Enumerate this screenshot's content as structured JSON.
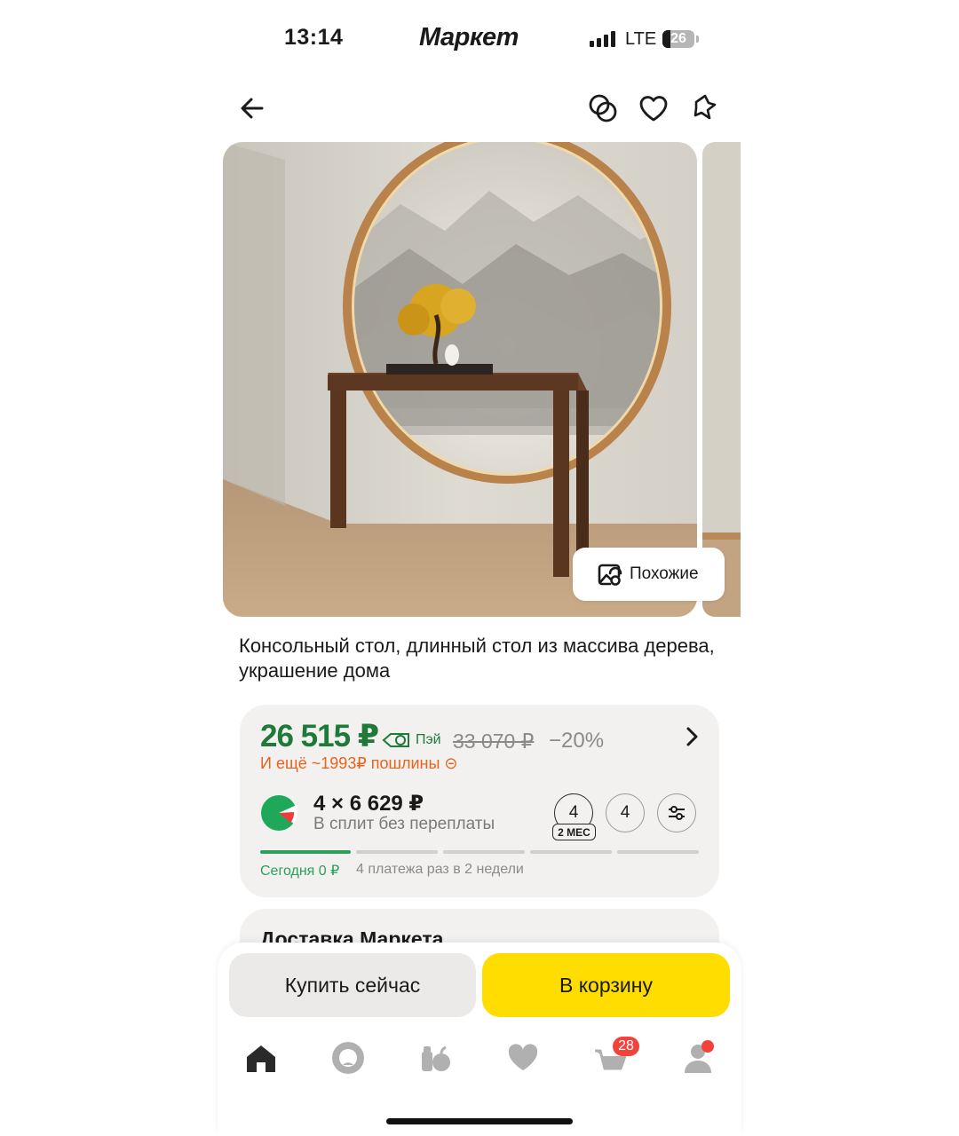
{
  "status_bar": {
    "time": "13:14",
    "app_name": "Маркет",
    "network": "LTE",
    "battery": "26",
    "battery_level": 0.26
  },
  "header": {
    "icons": [
      "back-arrow-icon",
      "compare-icon",
      "heart-icon",
      "share-icon"
    ]
  },
  "gallery": {
    "similar_label": "Похожие"
  },
  "product": {
    "title": "Консольный стол, длинный стол из массива дерева, украшение дома"
  },
  "price": {
    "current": "26 515 ₽",
    "pay_label": "Пэй",
    "old": "33 070 ₽",
    "discount": "−20%",
    "duty_note": "И ещё ~1993₽ пошлины ⊝",
    "split_amount": "4 × 6 629 ₽",
    "split_note": "В сплит без переплаты",
    "option_1": "4",
    "option_1_tag": "2 МЕС",
    "option_2": "4",
    "today": "Сегодня 0 ₽",
    "schedule": "4 платежа раз в 2 недели"
  },
  "delivery": {
    "title": "Доставка Маркета"
  },
  "actions": {
    "buy_now": "Купить сейчас",
    "add_to_cart": "В корзину"
  },
  "tabbar": {
    "cart_badge": "28"
  },
  "colors": {
    "price_green": "#1f7a3a",
    "duty_orange": "#e8631b",
    "cart_yellow": "#ffdd00",
    "badge_red": "#f2423a"
  }
}
